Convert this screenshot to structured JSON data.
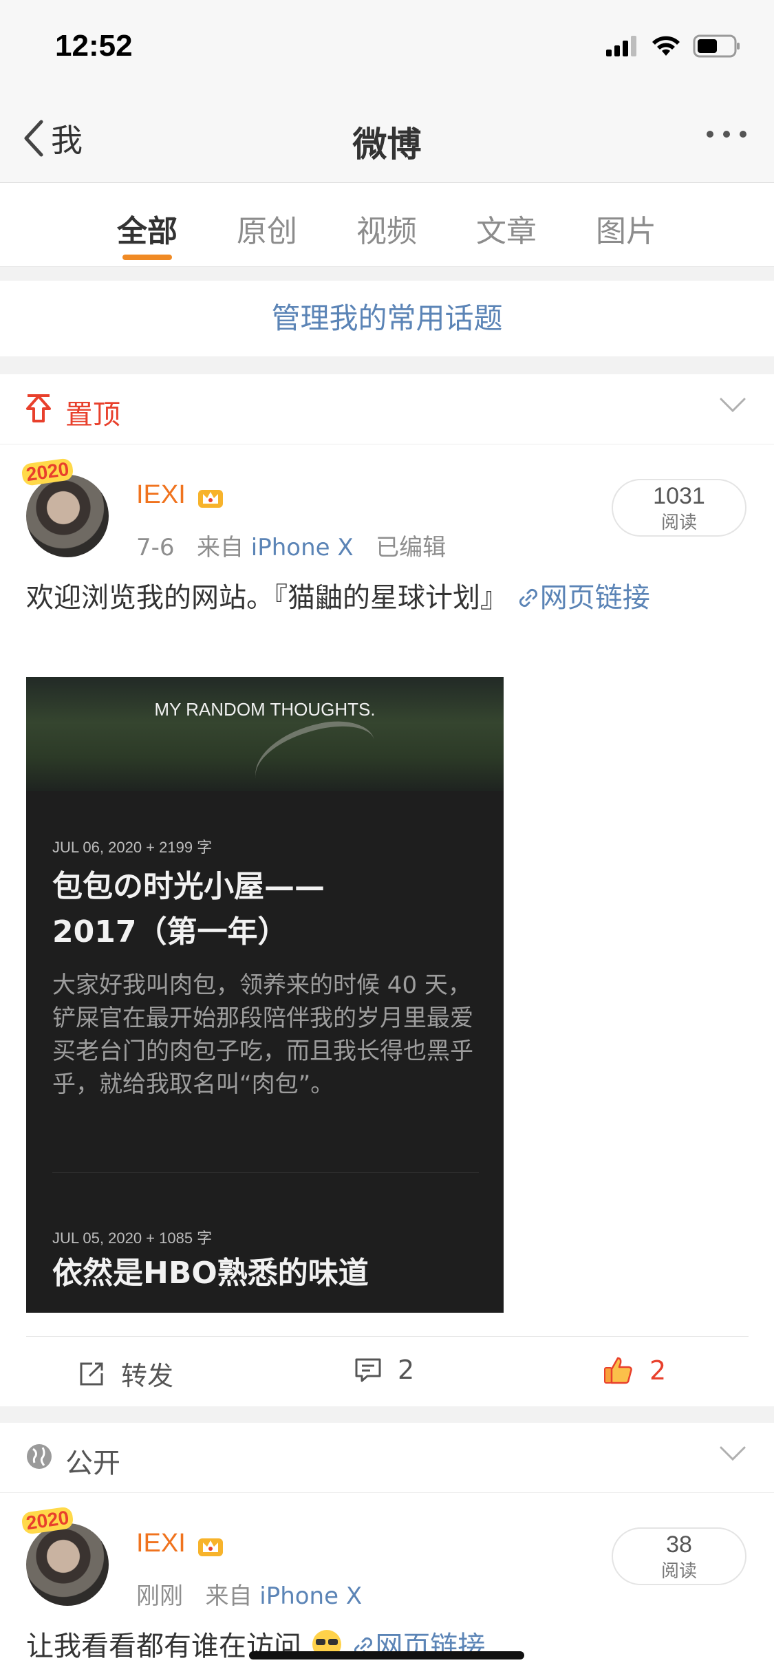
{
  "status_bar": {
    "time": "12:52"
  },
  "nav": {
    "back_label": "我",
    "title": "微博"
  },
  "tabs": [
    {
      "label": "全部",
      "active": true
    },
    {
      "label": "原创",
      "active": false
    },
    {
      "label": "视频",
      "active": false
    },
    {
      "label": "文章",
      "active": false
    },
    {
      "label": "图片",
      "active": false
    }
  ],
  "manage_topics": "管理我的常用话题",
  "pinned": {
    "label": "置顶"
  },
  "post1": {
    "avatar_badge": "2020",
    "username": "IEXI",
    "date": "7-6",
    "source_prefix": "来自",
    "source": "iPhone X",
    "edited": "已编辑",
    "read_count": "1031",
    "read_label": "阅读",
    "text": "欢迎浏览我的网站。『猫鼬的星球计划』",
    "link_text": "网页链接",
    "card": {
      "hero_title": "MY RANDOM THOUGHTS.",
      "article1": {
        "date": "JUL 06, 2020 + 2199 字",
        "title_line1": "包包の时光小屋——",
        "title_line2": "2017（第一年）",
        "excerpt": "大家好我叫肉包，领养来的时候 40 天，铲屎官在最开始那段陪伴我的岁月里最爱买老台门的肉包子吃，而且我长得也黑乎乎，就给我取名叫“肉包”。"
      },
      "article2": {
        "date": "JUL 05, 2020 + 1085 字",
        "title": "依然是HBO熟悉的味道"
      }
    },
    "actions": {
      "repost_label": "转发",
      "comment_count": "2",
      "like_count": "2"
    }
  },
  "public": {
    "label": "公开"
  },
  "post2": {
    "avatar_badge": "2020",
    "username": "IEXI",
    "date": "刚刚",
    "source_prefix": "来自",
    "source": "iPhone X",
    "read_count": "38",
    "read_label": "阅读",
    "text": "让我看看都有谁在访问",
    "link_text": "网页链接"
  },
  "colors": {
    "accent": "#f08a24",
    "link": "#5b84b6",
    "pinned": "#e8402c",
    "username": "#f0731e"
  }
}
